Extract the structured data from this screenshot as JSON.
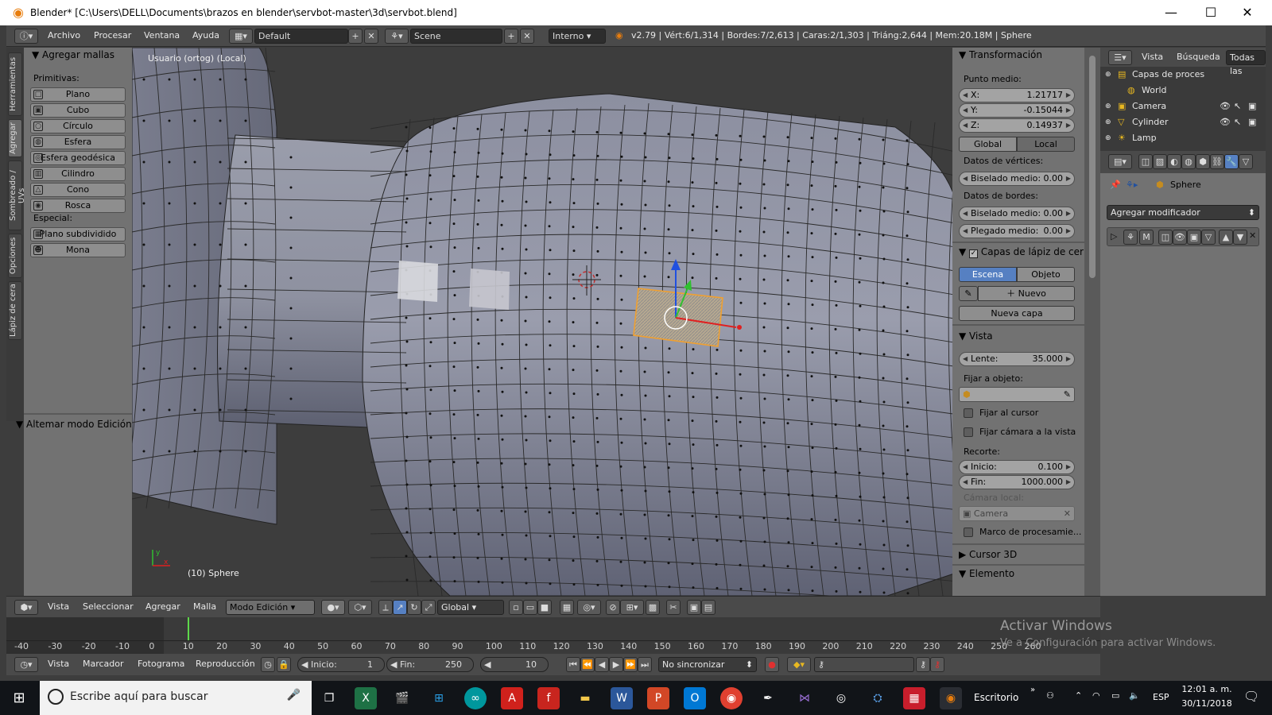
{
  "window": {
    "title": "Blender* [C:\\Users\\DELL\\Documents\\brazos en blender\\servbot-master\\3d\\servbot.blend]"
  },
  "info_header": {
    "menus": [
      "Archivo",
      "Procesar",
      "Ventana",
      "Ayuda"
    ],
    "screen_layout": "Default",
    "scene": "Scene",
    "render_engine": "Interno",
    "stats": "v2.79 | Vért:6/1,314 | Bordes:7/2,613 | Caras:2/1,303 | Triáng:2,644 | Mem:20.18M | Sphere"
  },
  "left_tabs": [
    "Herramientas",
    "Agregar",
    "Sombreado / UVs",
    "Opciones",
    "Lápiz de cera"
  ],
  "toolshelf": {
    "panel_title": "Agregar mallas",
    "primitives_label": "Primitivas:",
    "primitives": [
      {
        "label": "Plano",
        "icon": "plane-icon"
      },
      {
        "label": "Cubo",
        "icon": "cube-icon"
      },
      {
        "label": "Círculo",
        "icon": "circle-icon"
      },
      {
        "label": "Esfera",
        "icon": "uv-sphere-icon"
      },
      {
        "label": "Esfera geodésica",
        "icon": "ico-sphere-icon"
      },
      {
        "label": "Cilindro",
        "icon": "cylinder-icon"
      },
      {
        "label": "Cono",
        "icon": "cone-icon"
      },
      {
        "label": "Rosca",
        "icon": "torus-icon"
      }
    ],
    "special_label": "Especial:",
    "special": [
      {
        "label": "Plano subdividido",
        "icon": "grid-icon"
      },
      {
        "label": "Mona",
        "icon": "monkey-icon"
      }
    ],
    "operator_panel": "Altemar modo Edición"
  },
  "viewport": {
    "view_label": "Usuario (ortog) (Local)",
    "object_label": "(10) Sphere"
  },
  "npanel": {
    "transform_title": "Transformación",
    "median_label": "Punto medio:",
    "x": {
      "label": "X:",
      "value": "1.21717"
    },
    "y": {
      "label": "Y:",
      "value": "-0.15044"
    },
    "z": {
      "label": "Z:",
      "value": "0.14937"
    },
    "space_global": "Global",
    "space_local": "Local",
    "vertex_data": "Datos de vértices:",
    "vertex_bevel": {
      "label": "Biselado medio:",
      "value": "0.00"
    },
    "edge_data": "Datos de bordes:",
    "edge_bevel": {
      "label": "Biselado medio:",
      "value": "0.00"
    },
    "edge_crease": {
      "label": "Plegado medio:",
      "value": "0.00"
    },
    "gpencil_title": "Capas de lápiz de cer",
    "gp_scene": "Escena",
    "gp_object": "Objeto",
    "gp_new": "Nuevo",
    "gp_new_layer": "Nueva capa",
    "view_title": "Vista",
    "lens": {
      "label": "Lente:",
      "value": "35.000"
    },
    "lock_object": "Fijar a objeto:",
    "lock_cursor": "Fijar al cursor",
    "lock_camera": "Fijar cámara a la vista",
    "clip_label": "Recorte:",
    "clip_start": {
      "label": "Inicio:",
      "value": "0.100"
    },
    "clip_end": {
      "label": "Fin:",
      "value": "1000.000"
    },
    "local_camera_label": "Cámara local:",
    "local_camera": "Camera",
    "render_border": "Marco de procesamie...",
    "cursor_title": "Cursor 3D",
    "item_title": "Elemento"
  },
  "outliner": {
    "header_menus": [
      "Vista",
      "Búsqueda"
    ],
    "filter": "Todas las",
    "items": [
      {
        "label": "Capas de proces",
        "icon": "render-layers-icon"
      },
      {
        "label": "World",
        "icon": "world-icon"
      },
      {
        "label": "Camera",
        "icon": "camera-icon"
      },
      {
        "label": "Cylinder",
        "icon": "mesh-icon"
      },
      {
        "label": "Lamp",
        "icon": "lamp-icon"
      }
    ]
  },
  "properties": {
    "object_name": "Sphere",
    "add_modifier": "Agregar modificador",
    "modifier_tag": "M"
  },
  "view3d_header": {
    "menus": [
      "Vista",
      "Seleccionar",
      "Agregar",
      "Malla"
    ],
    "mode": "Modo Edición",
    "orientation": "Global"
  },
  "timeline": {
    "ticks": [
      "-40",
      "-30",
      "-20",
      "-10",
      "0",
      "10",
      "20",
      "30",
      "40",
      "50",
      "60",
      "70",
      "80",
      "90",
      "100",
      "110",
      "120",
      "130",
      "140",
      "150",
      "160",
      "170",
      "180",
      "190",
      "200",
      "210",
      "220",
      "230",
      "240",
      "250",
      "260"
    ],
    "current_frame": 10
  },
  "timeline_header": {
    "menus": [
      "Vista",
      "Marcador",
      "Fotograma",
      "Reproducción"
    ],
    "start": {
      "label": "Inicio:",
      "value": "1"
    },
    "end": {
      "label": "Fin:",
      "value": "250"
    },
    "current": "10",
    "sync": "No sincronizar"
  },
  "watermark": {
    "line1": "Activar Windows",
    "line2": "Ve a Configuración para activar Windows."
  },
  "taskbar": {
    "search_placeholder": "Escribe aquí para buscar",
    "desktop_label": "Escritorio",
    "language": "ESP",
    "time": "12:01 a. m.",
    "date": "30/11/2018"
  },
  "colors": {
    "accent_blue": "#5680c2",
    "selection_orange": "#f0a030",
    "blender_orange": "#e87d0d"
  }
}
